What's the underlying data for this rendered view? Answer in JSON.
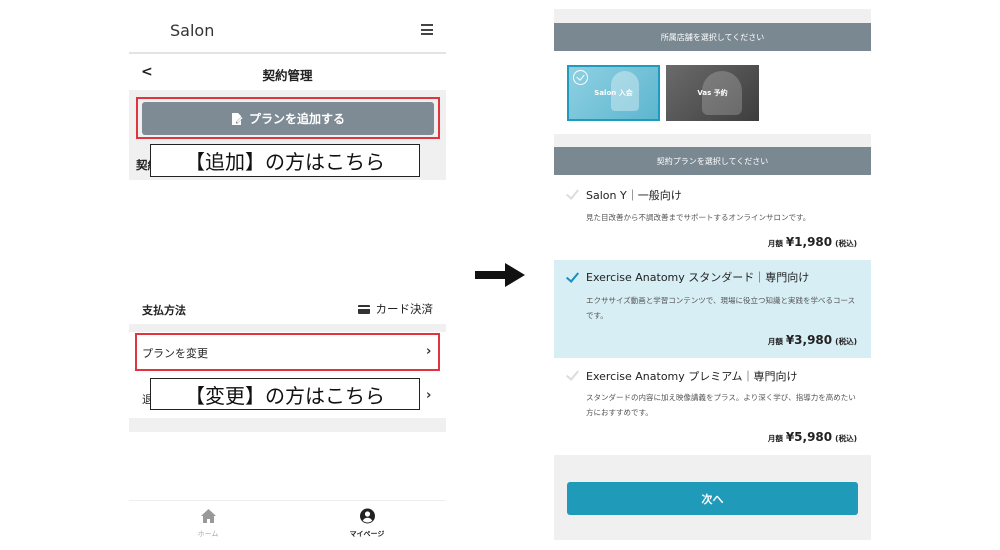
{
  "left": {
    "header": {
      "brand": "Salon"
    },
    "subheader": {
      "back": "<",
      "title": "契約管理"
    },
    "add_plan_button": "プランを追加する",
    "cut_label_1": "契約",
    "callout_add": "【追加】の方はこちら",
    "payment": {
      "label": "支払方法",
      "value": "カード決済"
    },
    "change_plan_label": "プランを変更",
    "cut_label_2": "退",
    "callout_change": "【変更】の方はこちら",
    "tabs": [
      {
        "label": "ホーム",
        "icon": "home-icon"
      },
      {
        "label": "マイページ",
        "icon": "user-circle-icon"
      }
    ]
  },
  "right": {
    "store_section_title": "所属店舗を選択してください",
    "stores": [
      {
        "label": "Salon 入会",
        "selected": true
      },
      {
        "label": "Vas 予約",
        "selected": false
      }
    ],
    "plan_section_title": "契約プランを選択してください",
    "plans": [
      {
        "name": "Salon Y｜一般向け",
        "description": "見た目改善から不調改善までサポートするオンラインサロンです。",
        "price_label": "月額",
        "price": "¥1,980",
        "tax": "(税込)",
        "selected": false
      },
      {
        "name": "Exercise Anatomy スタンダード｜専門向け",
        "description": "エクササイズ動画と学習コンテンツで、現場に役立つ知識と実践を学べるコースです。",
        "price_label": "月額",
        "price": "¥3,980",
        "tax": "(税込)",
        "selected": true
      },
      {
        "name": "Exercise Anatomy プレミアム｜専門向け",
        "description": "スタンダードの内容に加え映像講義をプラス。より深く学び、指導力を高めたい方におすすめです。",
        "price_label": "月額",
        "price": "¥5,980",
        "tax": "(税込)",
        "selected": false
      }
    ],
    "next_button": "次へ"
  },
  "colors": {
    "highlight_red": "#e0343f",
    "button_gray": "#7e8b95",
    "section_bar": "#7a8892",
    "accent_teal": "#1f9bb9",
    "selected_bg": "#d7eef4"
  }
}
